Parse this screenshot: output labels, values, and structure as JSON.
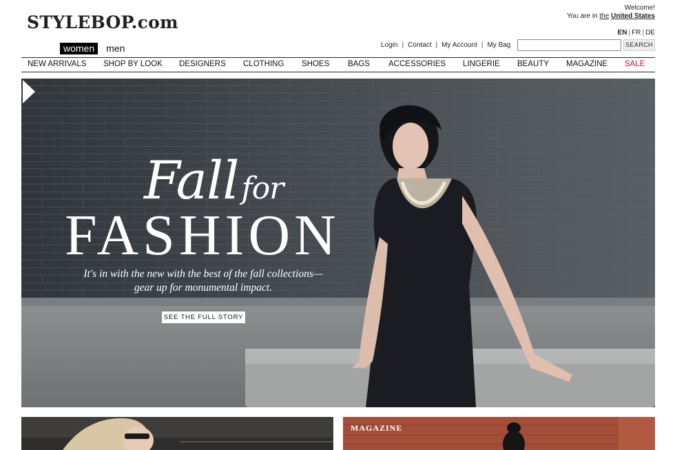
{
  "header": {
    "logo": "STYLEBOP.com",
    "gender_active": "women",
    "gender_inactive": "men",
    "welcome": "Welcome!",
    "location_prefix": "You are in",
    "location_the": "the",
    "location_country": "United States",
    "languages": {
      "active": "EN",
      "fr": "FR",
      "de": "DE"
    },
    "utility_links": {
      "login": "Login",
      "contact": "Contact",
      "account": "My Account",
      "bag": "My Bag"
    },
    "search": {
      "value": "",
      "placeholder": "",
      "button_label": "SEARCH"
    }
  },
  "nav": {
    "items": [
      "NEW ARRIVALS",
      "SHOP BY LOOK",
      "DESIGNERS",
      "CLOTHING",
      "SHOES",
      "BAGS",
      "ACCESSORIES",
      "LINGERIE",
      "BEAUTY",
      "MAGAZINE"
    ],
    "sale": "SALE",
    "sale_color": "#c8102e"
  },
  "hero": {
    "title_fall": "Fall",
    "title_for": "for",
    "title_fashion": "FASHION",
    "subtitle_line1": "It's in with the new with the best of the fall collections—",
    "subtitle_line2": "gear up for monumental impact.",
    "cta": "SEE THE FULL STORY",
    "next_icon": "chevron-right-icon"
  },
  "promos": {
    "right_label": "MAGAZINE"
  }
}
